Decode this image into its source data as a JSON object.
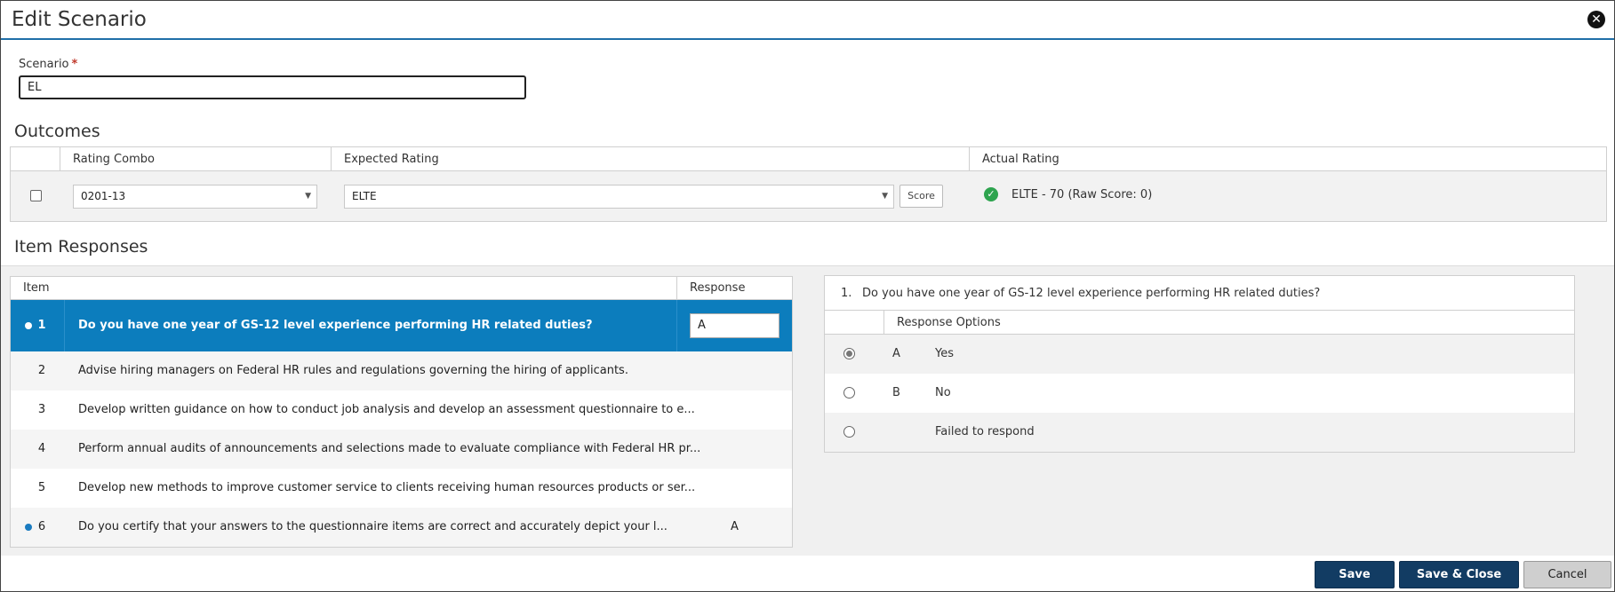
{
  "header": {
    "title": "Edit Scenario",
    "close_label": "✕"
  },
  "scenario": {
    "label": "Scenario",
    "required_mark": "*",
    "value": "EL"
  },
  "outcomes": {
    "title": "Outcomes",
    "columns": {
      "rating_combo": "Rating Combo",
      "expected_rating": "Expected Rating",
      "actual_rating": "Actual Rating"
    },
    "row": {
      "checked": false,
      "rating_combo": "0201-13",
      "expected_rating": "ELTE",
      "score_button": "Score",
      "actual_rating": "ELTE - 70 (Raw Score: 0)"
    }
  },
  "items": {
    "title": "Item Responses",
    "columns": {
      "item": "Item",
      "response": "Response"
    },
    "rows": [
      {
        "num": "1",
        "text": "Do you have one year of GS-12 level experience performing HR related duties?",
        "response": "A"
      },
      {
        "num": "2",
        "text": "Advise hiring managers on Federal HR rules and regulations governing the hiring of applicants.",
        "response": ""
      },
      {
        "num": "3",
        "text": "Develop written guidance on how to conduct job analysis and develop an assessment questionnaire to e...",
        "response": ""
      },
      {
        "num": "4",
        "text": "Perform annual audits of announcements and selections made to evaluate compliance with Federal HR pr...",
        "response": ""
      },
      {
        "num": "5",
        "text": "Develop new methods to improve customer service to clients receiving human resources products or ser...",
        "response": ""
      },
      {
        "num": "6",
        "text": "Do you certify that your answers to the questionnaire items are correct and accurately depict your l...",
        "response": "A"
      }
    ]
  },
  "detail": {
    "question_number": "1.",
    "question_text": "Do you have one year of GS-12 level experience performing HR related duties?",
    "options_header": "Response Options",
    "options": [
      {
        "letter": "A",
        "label": "Yes",
        "selected": true
      },
      {
        "letter": "B",
        "label": "No",
        "selected": false
      },
      {
        "letter": "",
        "label": "Failed to respond",
        "selected": false
      }
    ]
  },
  "footer": {
    "save": "Save",
    "save_close": "Save & Close",
    "cancel": "Cancel"
  },
  "colors": {
    "accent": "#0c7dbd",
    "primary_button": "#123c63",
    "success": "#2ea44f"
  }
}
